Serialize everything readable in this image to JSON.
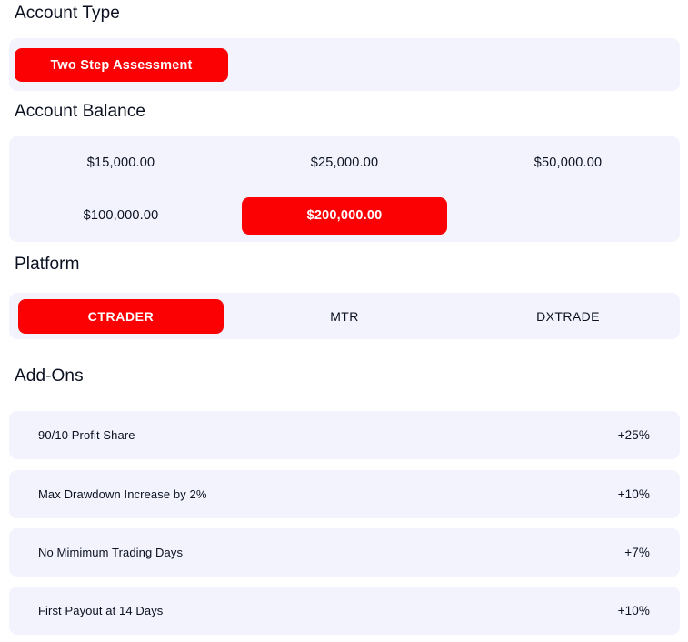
{
  "sections": {
    "account_type": {
      "heading": "Account Type",
      "options": [
        {
          "label": "Two Step Assessment",
          "selected": true
        }
      ]
    },
    "account_balance": {
      "heading": "Account Balance",
      "options": [
        {
          "label": "$15,000.00",
          "selected": false
        },
        {
          "label": "$25,000.00",
          "selected": false
        },
        {
          "label": "$50,000.00",
          "selected": false
        },
        {
          "label": "$100,000.00",
          "selected": false
        },
        {
          "label": "$200,000.00",
          "selected": true
        },
        {
          "label": "",
          "selected": false
        }
      ]
    },
    "platform": {
      "heading": "Platform",
      "options": [
        {
          "label": "CTRADER",
          "selected": true
        },
        {
          "label": "MTR",
          "selected": false
        },
        {
          "label": "DXTRADE",
          "selected": false
        }
      ]
    },
    "addons": {
      "heading": "Add-Ons",
      "items": [
        {
          "label": "90/10 Profit Share",
          "value": "+25%"
        },
        {
          "label": "Max Drawdown Increase by 2%",
          "value": "+10%"
        },
        {
          "label": "No Mimimum Trading Days",
          "value": "+7%"
        },
        {
          "label": "First Payout at 14 Days",
          "value": "+10%"
        }
      ]
    }
  },
  "colors": {
    "accent": "#FB0104",
    "panel": "#F2F3FD",
    "text": "#0B1120",
    "background": "#FFFFFF"
  }
}
